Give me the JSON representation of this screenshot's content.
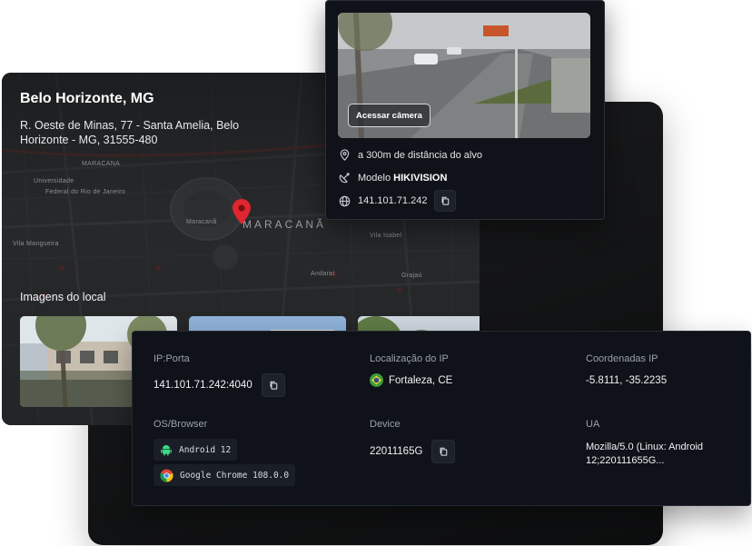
{
  "location": {
    "city": "Belo Horizonte, MG",
    "address": "R. Oeste de Minas, 77 - Santa Amelia, Belo Horizonte - MG, 31555-480",
    "images_title": "Imagens do local",
    "map_labels": [
      "MARACANA",
      "Maracanã",
      "Universidade",
      "Federal do Rio de Janeiro",
      "MARACANÃ",
      "Vila Mangueira",
      "Vila Isabel",
      "Andaraí",
      "Grajaú"
    ]
  },
  "camera": {
    "access_button": "Acessar câmera",
    "distance": "a 300m de distância do alvo",
    "model_prefix": "Modelo",
    "model_name": "HIKIVISION",
    "ip": "141.101.71.242",
    "icons": [
      "location-pin-icon",
      "satellite-dish-icon",
      "globe-icon",
      "copy-icon"
    ]
  },
  "info": {
    "ip_port_label": "IP:Porta",
    "ip_port_value": "141.101.71.242:4040",
    "ip_location_label": "Localização do IP",
    "ip_location_value": "Fortaleza, CE",
    "coords_label": "Coordenadas IP",
    "coords_value": "-5.8111, -35.2235",
    "os_label": "OS/Browser",
    "os_value": "Android 12",
    "browser_value": "Google Chrome 108.0.0",
    "device_label": "Device",
    "device_value": "22011165G",
    "ua_label": "UA",
    "ua_value": "Mozilla/5.0 (Linux: Android 12;220111655G..."
  },
  "colors": {
    "pin": "#e0262e",
    "panel_bg": "#0f1219",
    "android_green": "#3ddc84",
    "brazil_green": "#3a9b3a"
  }
}
